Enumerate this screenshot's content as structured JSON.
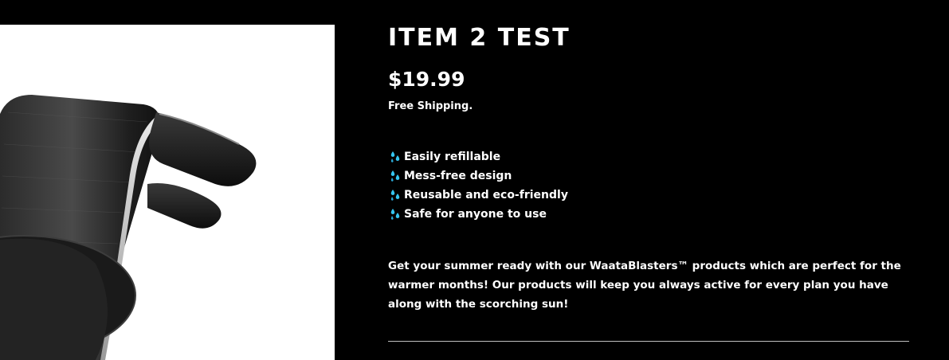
{
  "product": {
    "title": "ITEM 2 TEST",
    "price": "$19.99",
    "shipping": "Free Shipping.",
    "features": [
      {
        "icon": "water-droplets-icon",
        "label": "Easily refillable"
      },
      {
        "icon": "water-droplets-icon",
        "label": "Mess-free design"
      },
      {
        "icon": "water-droplets-icon",
        "label": "Reusable and eco-friendly"
      },
      {
        "icon": "water-droplets-icon",
        "label": "Safe for anyone to use"
      }
    ],
    "description": "Get your summer ready with our WaataBlasters™ products which are perfect for the warmer months! Our products will keep you always active for every plan you have along with the scorching sun!"
  },
  "colors": {
    "background": "#000000",
    "text": "#ffffff",
    "icon_accent": "#35c5f0",
    "divider": "#bfbfbf"
  }
}
